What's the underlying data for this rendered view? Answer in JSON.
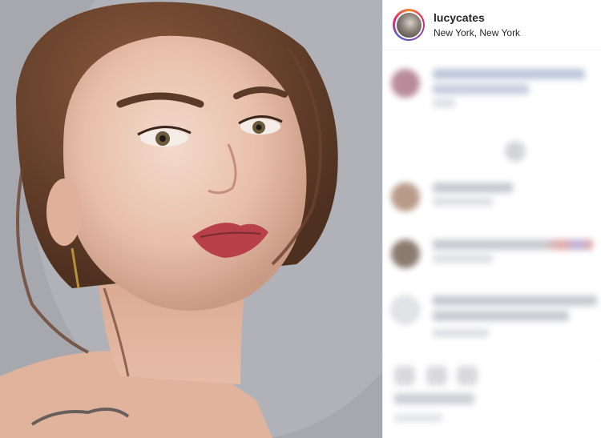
{
  "post": {
    "username": "lucycates",
    "location": "New York, New York"
  },
  "icons": {
    "avatar": "profile-photo",
    "comment_avatars": "avatar"
  }
}
